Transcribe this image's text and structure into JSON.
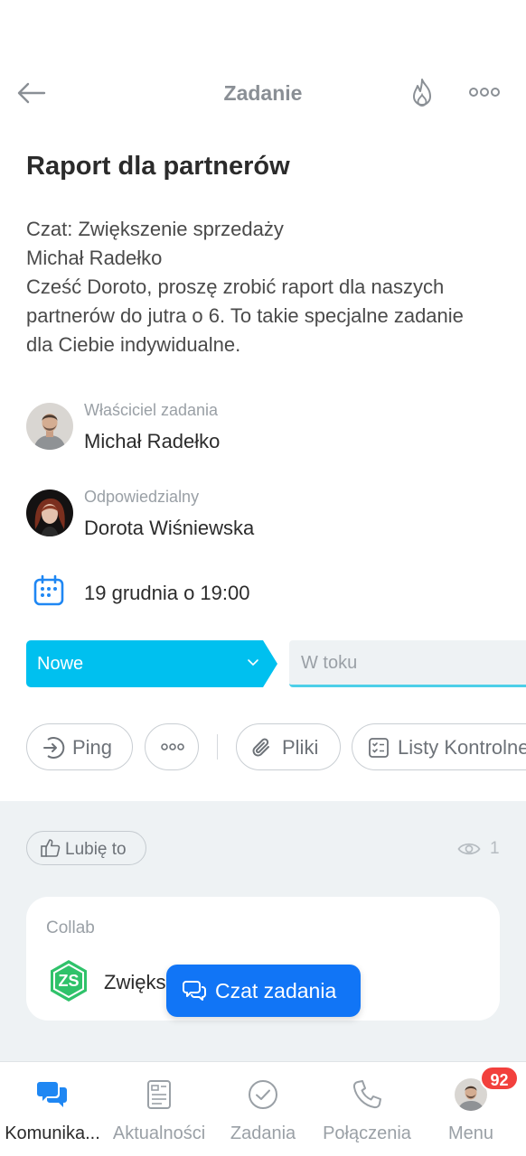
{
  "header": {
    "title": "Zadanie",
    "back_icon": "arrow-left-icon",
    "fire_icon": "flame-icon",
    "more_icon": "more-horizontal-icon"
  },
  "task": {
    "title": "Raport dla partnerów",
    "description": [
      "Czat: Zwiększenie sprzedaży",
      "Michał Radełko",
      "Cześć Doroto, proszę zrobić raport dla naszych",
      "partnerów do jutra o 6. To takie specjalne zadanie",
      "dla Ciebie indywidualne."
    ]
  },
  "owner": {
    "role": "Właściciel zadania",
    "name": "Michał Radełko"
  },
  "responsible": {
    "role": "Odpowiedzialny",
    "name": "Dorota Wiśniewska"
  },
  "deadline": {
    "text": "19 grudnia o 19:00",
    "icon": "calendar-icon"
  },
  "status": {
    "current": "Nowe",
    "next": "W toku",
    "accent": "#00c0ef"
  },
  "actions": {
    "ping": "Ping",
    "more": "more-horizontal-icon",
    "files": "Pliki",
    "checklists": "Listy Kontrolne"
  },
  "feed": {
    "like": "Lubię to",
    "views": "1",
    "collab_label": "Collab",
    "collab_initials": "ZS",
    "collab_name": "Zwiększenie sprzedaży"
  },
  "chat_button": {
    "label": "Czat zadania",
    "color": "#1175f6"
  },
  "tabbar": {
    "tabs": [
      {
        "label": "Komunika...",
        "icon": "chat-bubbles-icon"
      },
      {
        "label": "Aktualności",
        "icon": "news-icon"
      },
      {
        "label": "Zadania",
        "icon": "check-circle-icon"
      },
      {
        "label": "Połączenia",
        "icon": "phone-icon"
      },
      {
        "label": "Menu",
        "icon": "avatar"
      }
    ],
    "menu_badge": "92",
    "badge_color": "#f2403d"
  }
}
